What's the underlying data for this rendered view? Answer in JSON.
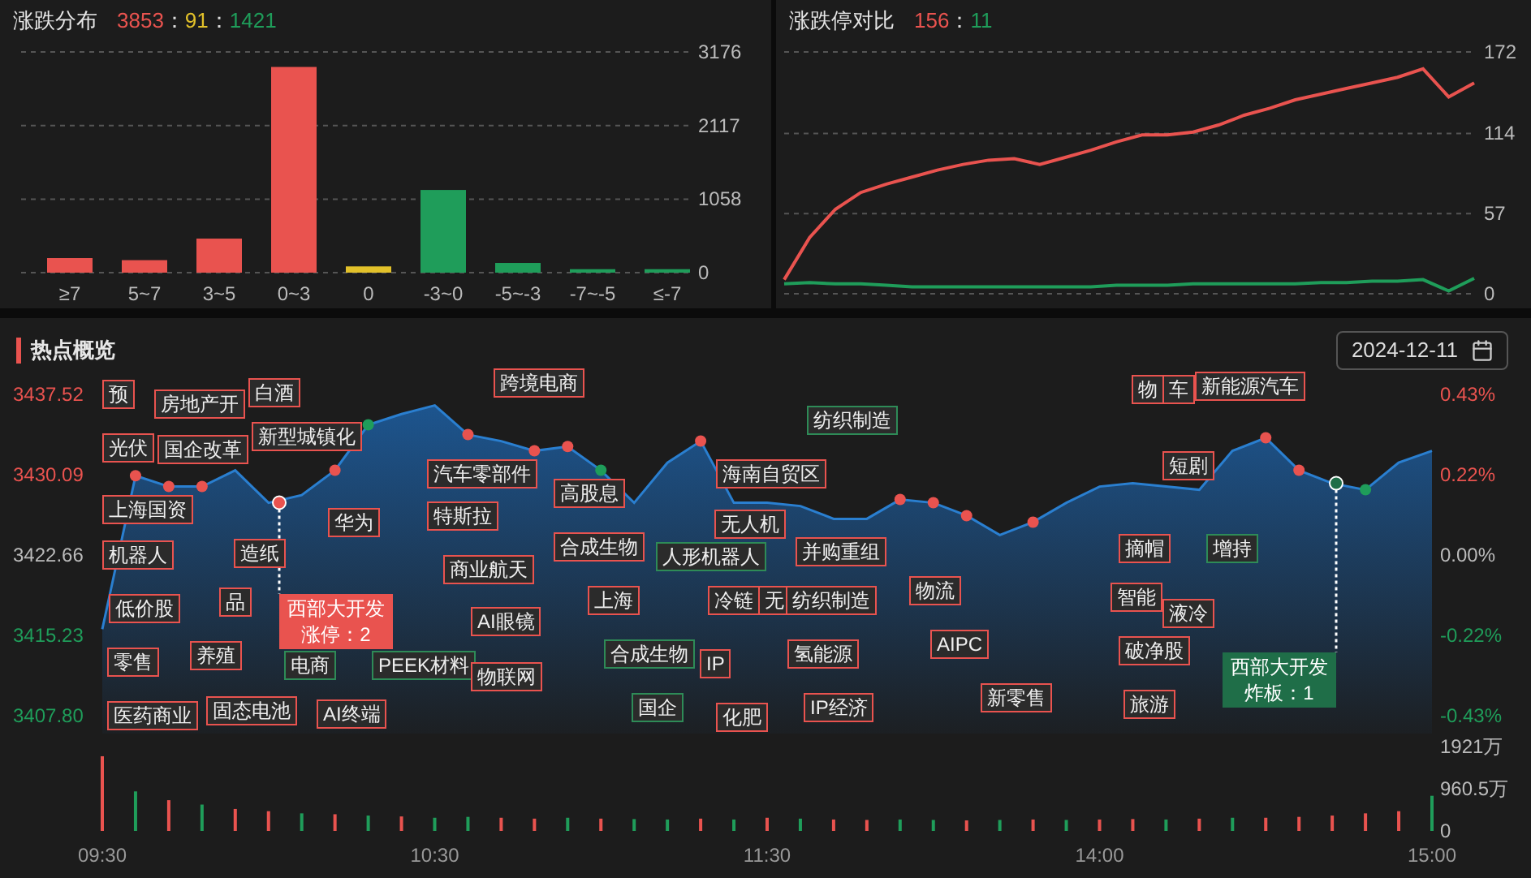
{
  "distribution": {
    "title": "涨跌分布",
    "counts": [
      {
        "text": "3853",
        "color": "#e9534f"
      },
      {
        "text": "：",
        "color": "#dddddd"
      },
      {
        "text": "91",
        "color": "#e2c12a"
      },
      {
        "text": "：",
        "color": "#dddddd"
      },
      {
        "text": "1421",
        "color": "#1f9d5a"
      }
    ],
    "chart_data": {
      "type": "bar",
      "categories": [
        "≥7",
        "5~7",
        "3~5",
        "0~3",
        "0",
        "-3~0",
        "-5~-3",
        "-7~-5",
        "≤-7"
      ],
      "series": [
        {
          "color": "#e9534f",
          "values": [
            210,
            180,
            490,
            2960,
            null,
            null,
            null,
            null,
            null
          ]
        },
        {
          "color": "#e2c12a",
          "values": [
            null,
            null,
            null,
            null,
            90,
            null,
            null,
            null,
            null
          ]
        },
        {
          "color": "#1f9d5a",
          "values": [
            null,
            null,
            null,
            null,
            null,
            1190,
            140,
            50,
            50
          ]
        }
      ],
      "ylim": [
        0,
        3176
      ],
      "yticks": [
        {
          "value": 0,
          "label": "0"
        },
        {
          "value": 1058,
          "label": "1058"
        },
        {
          "value": 2117,
          "label": "2117"
        },
        {
          "value": 3176,
          "label": "3176"
        }
      ]
    }
  },
  "limit_compare": {
    "title": "涨跌停对比",
    "counts": [
      {
        "text": "156",
        "color": "#e9534f"
      },
      {
        "text": "：",
        "color": "#dddddd"
      },
      {
        "text": "11",
        "color": "#1f9d5a"
      }
    ],
    "chart_data": {
      "type": "line",
      "categories": [
        null,
        null,
        null,
        null,
        null,
        null,
        null,
        null,
        null,
        null,
        null,
        null,
        null,
        null,
        null,
        null,
        null,
        null,
        null,
        null,
        null,
        null,
        null,
        null,
        null,
        null,
        null,
        null
      ],
      "series": [
        {
          "color": "#e9534f",
          "values": [
            10,
            40,
            60,
            72,
            78,
            83,
            88,
            92,
            95,
            96,
            92,
            97,
            102,
            108,
            113,
            113,
            115,
            120,
            127,
            132,
            138,
            142,
            146,
            150,
            154,
            160,
            140,
            150
          ]
        },
        {
          "color": "#1f9d5a",
          "values": [
            7,
            8,
            7,
            7,
            6,
            5,
            5,
            5,
            5,
            5,
            5,
            5,
            5,
            6,
            6,
            6,
            7,
            7,
            7,
            7,
            7,
            8,
            8,
            9,
            9,
            10,
            2,
            11
          ]
        }
      ],
      "ylim": [
        0,
        172
      ],
      "yticks": [
        {
          "value": 0,
          "label": "0"
        },
        {
          "value": 57,
          "label": "57"
        },
        {
          "value": 114,
          "label": "114"
        },
        {
          "value": 172,
          "label": "172"
        }
      ]
    }
  },
  "hotspots": {
    "title": "热点概览",
    "date": "2024-12-11",
    "chart_data": {
      "type": "area",
      "categories": [
        null,
        null,
        null,
        null,
        null,
        null,
        null,
        null,
        null,
        null,
        null,
        null,
        null,
        null,
        null,
        null,
        null,
        null,
        null,
        null,
        null,
        null,
        null,
        null,
        null,
        null,
        null,
        null,
        null,
        null,
        null,
        null,
        null,
        null,
        null,
        null,
        null,
        null,
        null,
        null,
        null
      ],
      "series": [
        {
          "color": "#2a7fd0",
          "values": [
            3415.8,
            3430.0,
            3429.0,
            3429.0,
            3430.5,
            3427.5,
            3428.2,
            3430.5,
            3434.7,
            3435.7,
            3436.5,
            3433.8,
            3433.2,
            3432.3,
            3432.7,
            3430.5,
            3427.5,
            3431.2,
            3433.2,
            3427.5,
            3427.5,
            3427.2,
            3426.0,
            3426.0,
            3427.8,
            3427.5,
            3426.3,
            3424.5,
            3425.7,
            3427.5,
            3429.0,
            3429.3,
            3429.0,
            3428.7,
            3432.3,
            3433.5,
            3430.5,
            3429.3,
            3428.7,
            3431.2,
            3432.3
          ]
        }
      ],
      "ylim": [
        3407.8,
        3437.52
      ],
      "yticks": [
        {
          "value": 3407.8,
          "label": "3407.80"
        },
        {
          "value": 3415.23,
          "label": "3415.23"
        },
        {
          "value": 3422.66,
          "label": "3422.66"
        },
        {
          "value": 3430.09,
          "label": "3430.09"
        },
        {
          "value": 3437.52,
          "label": "3437.52"
        }
      ]
    },
    "percent_axis": [
      "0.43%",
      "0.22%",
      "0.00%",
      "-0.22%",
      "-0.43%"
    ],
    "markers": [
      {
        "color": "#e9534f"
      },
      {
        "color": "#e9534f"
      },
      {
        "color": "#e9534f"
      },
      {
        "color": "#e9534f"
      },
      {
        "color": "#1f9d5a"
      },
      {
        "color": "#e9534f"
      },
      {
        "color": "#e9534f"
      },
      {
        "color": "#e9534f"
      },
      {
        "color": "#1f9d5a"
      },
      {
        "color": "#e9534f"
      },
      {
        "color": "#e9534f"
      },
      {
        "color": "#e9534f"
      },
      {
        "color": "#e9534f"
      },
      {
        "color": "#e9534f"
      },
      {
        "color": "#e9534f"
      },
      {
        "color": "#e9534f"
      },
      {
        "color": "#1f9d5a"
      }
    ],
    "tags": [
      {
        "text": "预",
        "color": "#e9534f"
      },
      {
        "text": "房地产开",
        "color": "#e9534f"
      },
      {
        "text": "白酒",
        "color": "#e9534f"
      },
      {
        "text": "新型城镇化",
        "color": "#e9534f"
      },
      {
        "text": "光伏",
        "color": "#e9534f"
      },
      {
        "text": "国企改革",
        "color": "#e9534f"
      },
      {
        "text": "上海国资",
        "color": "#e9534f"
      },
      {
        "text": "机器人",
        "color": "#e9534f"
      },
      {
        "text": "造纸",
        "color": "#e9534f"
      },
      {
        "text": "华为",
        "color": "#e9534f"
      },
      {
        "text": "低价股",
        "color": "#e9534f"
      },
      {
        "text": "品",
        "color": "#e9534f"
      },
      {
        "text": "零售",
        "color": "#e9534f"
      },
      {
        "text": "养殖",
        "color": "#e9534f"
      },
      {
        "text": "电商",
        "color": "#2e8b57"
      },
      {
        "text": "PEEK材料",
        "color": "#2e8b57"
      },
      {
        "text": "医药商业",
        "color": "#e9534f"
      },
      {
        "text": "固态电池",
        "color": "#e9534f"
      },
      {
        "text": "AI终端",
        "color": "#e9534f"
      },
      {
        "text": "跨境电商",
        "color": "#e9534f"
      },
      {
        "text": "汽车零部件",
        "color": "#e9534f"
      },
      {
        "text": "特斯拉",
        "color": "#e9534f"
      },
      {
        "text": "商业航天",
        "color": "#e9534f"
      },
      {
        "text": "AI眼镜",
        "color": "#e9534f"
      },
      {
        "text": "物联网",
        "color": "#e9534f"
      },
      {
        "text": "高股息",
        "color": "#e9534f"
      },
      {
        "text": "合成生物",
        "color": "#e9534f"
      },
      {
        "text": "人形机器人",
        "color": "#2e8b57"
      },
      {
        "text": "上海",
        "color": "#e9534f"
      },
      {
        "text": "合成生物",
        "color": "#2e8b57"
      },
      {
        "text": "国企",
        "color": "#2e8b57"
      },
      {
        "text": "纺织制造",
        "color": "#2e8b57"
      },
      {
        "text": "海南自贸区",
        "color": "#e9534f"
      },
      {
        "text": "无人机",
        "color": "#e9534f"
      },
      {
        "text": "并购重组",
        "color": "#e9534f"
      },
      {
        "text": "冷链",
        "color": "#e9534f"
      },
      {
        "text": "无",
        "color": "#e9534f"
      },
      {
        "text": "纺织制造",
        "color": "#e9534f"
      },
      {
        "text": "IP",
        "color": "#e9534f"
      },
      {
        "text": "氢能源",
        "color": "#e9534f"
      },
      {
        "text": "化肥",
        "color": "#e9534f"
      },
      {
        "text": "IP经济",
        "color": "#e9534f"
      },
      {
        "text": "物流",
        "color": "#e9534f"
      },
      {
        "text": "AIPC",
        "color": "#e9534f"
      },
      {
        "text": "新零售",
        "color": "#e9534f"
      },
      {
        "text": "物",
        "color": "#e9534f"
      },
      {
        "text": "车",
        "color": "#e9534f"
      },
      {
        "text": "新能源汽车",
        "color": "#e9534f"
      },
      {
        "text": "短剧",
        "color": "#e9534f"
      },
      {
        "text": "摘帽",
        "color": "#e9534f"
      },
      {
        "text": "增持",
        "color": "#2e8b57"
      },
      {
        "text": "智能",
        "color": "#e9534f"
      },
      {
        "text": "液冷",
        "color": "#e9534f"
      },
      {
        "text": "破净股",
        "color": "#e9534f"
      },
      {
        "text": "旅游",
        "color": "#e9534f"
      }
    ],
    "callouts": [
      {
        "title": "西部大开发",
        "detail": "涨停：2",
        "color": "#e9534f"
      },
      {
        "title": "西部大开发",
        "detail": "炸板：1",
        "color": "#1f6e48"
      }
    ],
    "volume": {
      "chart_data": {
        "type": "bar",
        "categories": [
          "09:30",
          null,
          null,
          null,
          null,
          null,
          null,
          null,
          null,
          null,
          "10:30",
          null,
          null,
          null,
          null,
          null,
          null,
          null,
          null,
          null,
          "11:30",
          null,
          null,
          null,
          null,
          null,
          null,
          null,
          null,
          null,
          "14:00",
          null,
          null,
          null,
          null,
          null,
          null,
          null,
          null,
          null,
          "15:00"
        ],
        "series": [
          {
            "color": "#e9534f",
            "values": [
              1700,
              null,
              700,
              null,
              500,
              450,
              null,
              380,
              null,
              330,
              null,
              null,
              300,
              280,
              null,
              280,
              null,
              null,
              280,
              null,
              300,
              null,
              260,
              250,
              null,
              null,
              240,
              null,
              260,
              null,
              260,
              270,
              null,
              280,
              null,
              300,
              320,
              350,
              400,
              450,
              null
            ]
          },
          {
            "color": "#1f9d5a",
            "values": [
              null,
              900,
              null,
              600,
              null,
              null,
              400,
              null,
              350,
              null,
              300,
              320,
              null,
              null,
              300,
              null,
              270,
              260,
              null,
              260,
              null,
              280,
              null,
              null,
              260,
              250,
              null,
              250,
              null,
              250,
              null,
              null,
              260,
              null,
              300,
              null,
              null,
              null,
              null,
              null,
              800
            ]
          }
        ],
        "ylim": [
          0,
          1921
        ],
        "yticks": [
          {
            "value": 0,
            "label": "0"
          },
          {
            "value": 960.5,
            "label": "960.5万"
          },
          {
            "value": 1921,
            "label": "1921万"
          }
        ]
      }
    }
  }
}
